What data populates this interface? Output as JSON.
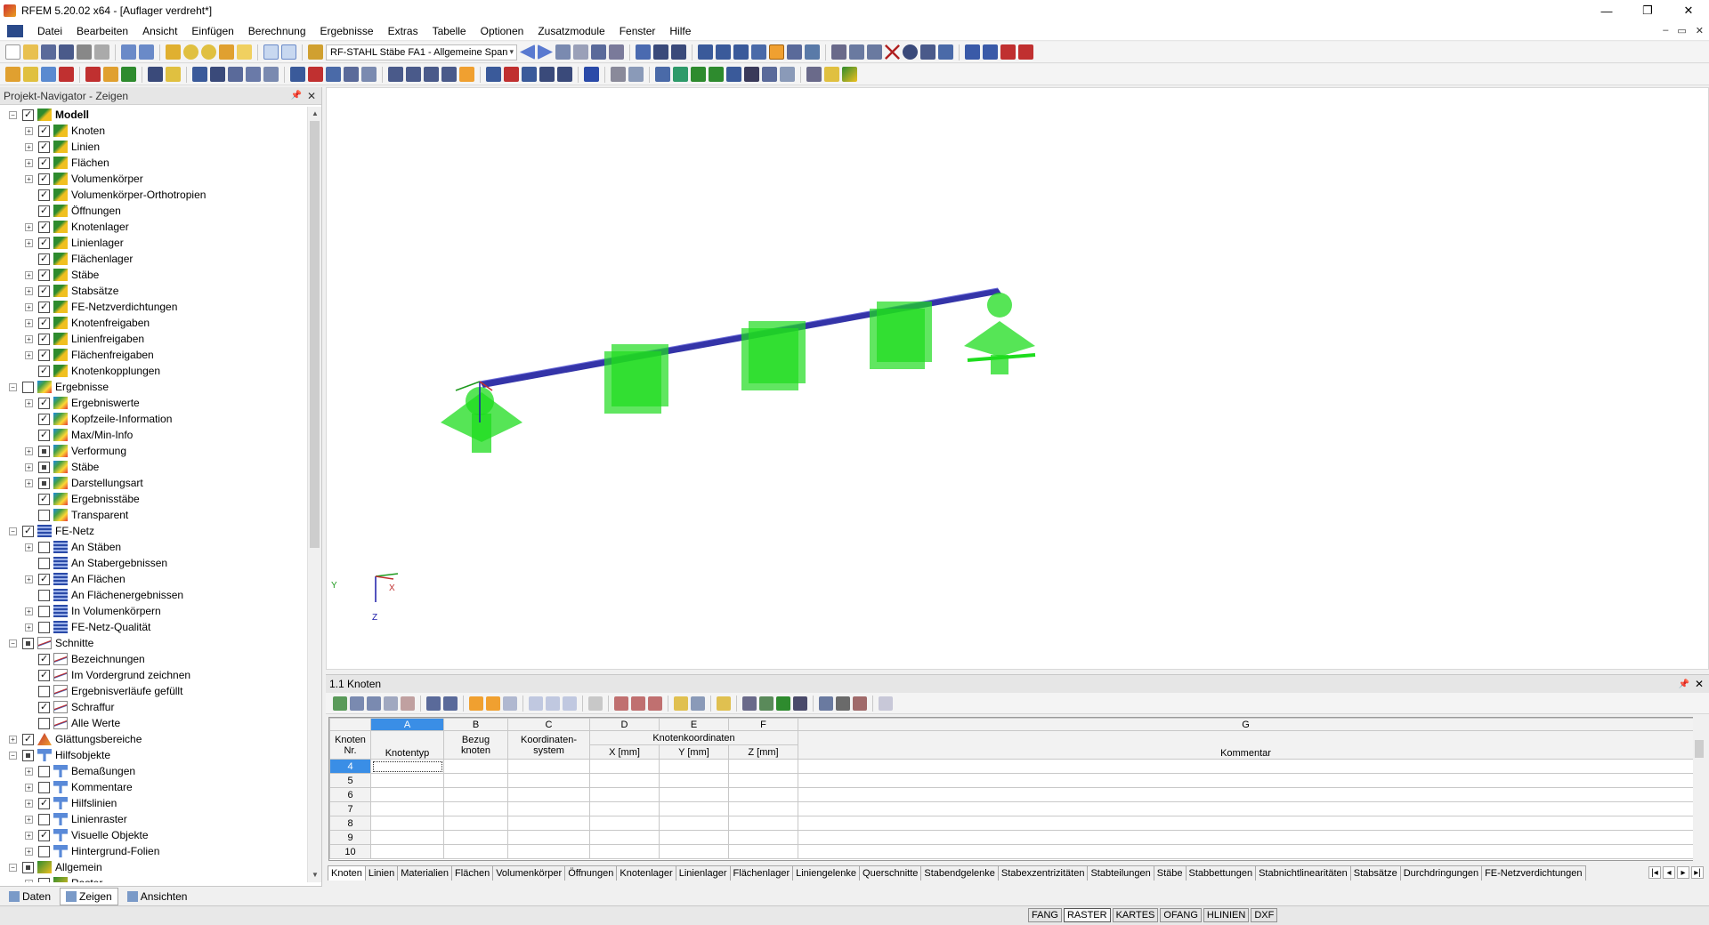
{
  "title": "RFEM 5.20.02 x64 - [Auflager verdreht*]",
  "menu": [
    "Datei",
    "Bearbeiten",
    "Ansicht",
    "Einfügen",
    "Berechnung",
    "Ergebnisse",
    "Extras",
    "Tabelle",
    "Optionen",
    "Zusatzmodule",
    "Fenster",
    "Hilfe"
  ],
  "toolbar": {
    "combo": "RF-STAHL Stäbe FA1 - Allgemeine Span"
  },
  "navigator": {
    "header": "Projekt-Navigator - Zeigen",
    "items": [
      {
        "label": "Modell",
        "level": 0,
        "exp": "-",
        "cb": "on",
        "icon": "model",
        "bold": true
      },
      {
        "label": "Knoten",
        "level": 1,
        "exp": "+",
        "cb": "on",
        "icon": "model"
      },
      {
        "label": "Linien",
        "level": 1,
        "exp": "+",
        "cb": "on",
        "icon": "model"
      },
      {
        "label": "Flächen",
        "level": 1,
        "exp": "+",
        "cb": "on",
        "icon": "model"
      },
      {
        "label": "Volumenkörper",
        "level": 1,
        "exp": "+",
        "cb": "on",
        "icon": "model"
      },
      {
        "label": "Volumenkörper-Orthotropien",
        "level": 1,
        "exp": "",
        "cb": "on",
        "icon": "model"
      },
      {
        "label": "Öffnungen",
        "level": 1,
        "exp": "",
        "cb": "on",
        "icon": "model"
      },
      {
        "label": "Knotenlager",
        "level": 1,
        "exp": "+",
        "cb": "on",
        "icon": "model"
      },
      {
        "label": "Linienlager",
        "level": 1,
        "exp": "+",
        "cb": "on",
        "icon": "model"
      },
      {
        "label": "Flächenlager",
        "level": 1,
        "exp": "",
        "cb": "on",
        "icon": "model"
      },
      {
        "label": "Stäbe",
        "level": 1,
        "exp": "+",
        "cb": "on",
        "icon": "model"
      },
      {
        "label": "Stabsätze",
        "level": 1,
        "exp": "+",
        "cb": "on",
        "icon": "model"
      },
      {
        "label": "FE-Netzverdichtungen",
        "level": 1,
        "exp": "+",
        "cb": "on",
        "icon": "model"
      },
      {
        "label": "Knotenfreigaben",
        "level": 1,
        "exp": "+",
        "cb": "on",
        "icon": "model"
      },
      {
        "label": "Linienfreigaben",
        "level": 1,
        "exp": "+",
        "cb": "on",
        "icon": "model"
      },
      {
        "label": "Flächenfreigaben",
        "level": 1,
        "exp": "+",
        "cb": "on",
        "icon": "model"
      },
      {
        "label": "Knotenkopplungen",
        "level": 1,
        "exp": "",
        "cb": "on",
        "icon": "model"
      },
      {
        "label": "Ergebnisse",
        "level": 0,
        "exp": "-",
        "cb": "",
        "icon": "res"
      },
      {
        "label": "Ergebniswerte",
        "level": 1,
        "exp": "+",
        "cb": "on",
        "icon": "res"
      },
      {
        "label": "Kopfzeile-Information",
        "level": 1,
        "exp": "",
        "cb": "on",
        "icon": "res"
      },
      {
        "label": "Max/Min-Info",
        "level": 1,
        "exp": "",
        "cb": "on",
        "icon": "res"
      },
      {
        "label": "Verformung",
        "level": 1,
        "exp": "+",
        "cb": "part",
        "icon": "res"
      },
      {
        "label": "Stäbe",
        "level": 1,
        "exp": "+",
        "cb": "part",
        "icon": "res"
      },
      {
        "label": "Darstellungsart",
        "level": 1,
        "exp": "+",
        "cb": "part",
        "icon": "res"
      },
      {
        "label": "Ergebnisstäbe",
        "level": 1,
        "exp": "",
        "cb": "on",
        "icon": "res"
      },
      {
        "label": "Transparent",
        "level": 1,
        "exp": "",
        "cb": "",
        "icon": "res"
      },
      {
        "label": "FE-Netz",
        "level": 0,
        "exp": "-",
        "cb": "on",
        "icon": "mesh"
      },
      {
        "label": "An Stäben",
        "level": 1,
        "exp": "+",
        "cb": "",
        "icon": "mesh"
      },
      {
        "label": "An Stabergebnissen",
        "level": 1,
        "exp": "",
        "cb": "",
        "icon": "mesh"
      },
      {
        "label": "An Flächen",
        "level": 1,
        "exp": "+",
        "cb": "on",
        "icon": "mesh"
      },
      {
        "label": "An Flächenergebnissen",
        "level": 1,
        "exp": "",
        "cb": "",
        "icon": "mesh"
      },
      {
        "label": "In Volumenkörpern",
        "level": 1,
        "exp": "+",
        "cb": "",
        "icon": "mesh"
      },
      {
        "label": "FE-Netz-Qualität",
        "level": 1,
        "exp": "+",
        "cb": "",
        "icon": "mesh"
      },
      {
        "label": "Schnitte",
        "level": 0,
        "exp": "-",
        "cb": "part",
        "icon": "sec"
      },
      {
        "label": "Bezeichnungen",
        "level": 1,
        "exp": "",
        "cb": "on",
        "icon": "sec"
      },
      {
        "label": "Im Vordergrund zeichnen",
        "level": 1,
        "exp": "",
        "cb": "on",
        "icon": "sec"
      },
      {
        "label": "Ergebnisverläufe gefüllt",
        "level": 1,
        "exp": "",
        "cb": "",
        "icon": "sec"
      },
      {
        "label": "Schraffur",
        "level": 1,
        "exp": "",
        "cb": "on",
        "icon": "sec"
      },
      {
        "label": "Alle Werte",
        "level": 1,
        "exp": "",
        "cb": "",
        "icon": "sec"
      },
      {
        "label": "Glättungsbereiche",
        "level": 0,
        "exp": "+",
        "cb": "on",
        "icon": "smooth"
      },
      {
        "label": "Hilfsobjekte",
        "level": 0,
        "exp": "-",
        "cb": "part",
        "icon": "help"
      },
      {
        "label": "Bemaßungen",
        "level": 1,
        "exp": "+",
        "cb": "",
        "icon": "help"
      },
      {
        "label": "Kommentare",
        "level": 1,
        "exp": "+",
        "cb": "",
        "icon": "help"
      },
      {
        "label": "Hilfslinien",
        "level": 1,
        "exp": "+",
        "cb": "on",
        "icon": "help"
      },
      {
        "label": "Linienraster",
        "level": 1,
        "exp": "+",
        "cb": "",
        "icon": "help"
      },
      {
        "label": "Visuelle Objekte",
        "level": 1,
        "exp": "+",
        "cb": "on",
        "icon": "help"
      },
      {
        "label": "Hintergrund-Folien",
        "level": 1,
        "exp": "+",
        "cb": "",
        "icon": "help"
      },
      {
        "label": "Allgemein",
        "level": 0,
        "exp": "-",
        "cb": "part",
        "icon": "gen"
      },
      {
        "label": "Raster",
        "level": 1,
        "exp": "+",
        "cb": "",
        "icon": "gen"
      }
    ],
    "tabs": [
      "Daten",
      "Zeigen",
      "Ansichten"
    ]
  },
  "viewport": {
    "axis_y": "Y",
    "axis_x": "X",
    "axis_z": "Z"
  },
  "table": {
    "title": "1.1 Knoten",
    "col_letters": [
      "A",
      "B",
      "C",
      "D",
      "E",
      "F",
      "G"
    ],
    "h_knoten": "Knoten",
    "h_nr": "Nr.",
    "h_knotentyp": "Knotentyp",
    "h_bezug1": "Bezug",
    "h_bezug2": "knoten",
    "h_koord1": "Koordinaten-",
    "h_koord2": "system",
    "h_knotenkoord": "Knotenkoordinaten",
    "h_x": "X [mm]",
    "h_y": "Y [mm]",
    "h_z": "Z [mm]",
    "h_kommentar": "Kommentar",
    "rows": [
      "4",
      "5",
      "6",
      "7",
      "8",
      "9",
      "10"
    ],
    "tabs": [
      "Knoten",
      "Linien",
      "Materialien",
      "Flächen",
      "Volumenkörper",
      "Öffnungen",
      "Knotenlager",
      "Linienlager",
      "Flächenlager",
      "Liniengelenke",
      "Querschnitte",
      "Stabendgelenke",
      "Stabexzentrizitäten",
      "Stabteilungen",
      "Stäbe",
      "Stabbettungen",
      "Stabnichtlinearitäten",
      "Stabsätze",
      "Durchdringungen",
      "FE-Netzverdichtungen"
    ]
  },
  "status": [
    "FANG",
    "RASTER",
    "KARTES",
    "OFANG",
    "HLINIEN",
    "DXF"
  ],
  "colors": {
    "support_green": "#1edc1e",
    "beam_blue": "#3434a8",
    "accent": "#3a8ee6"
  }
}
